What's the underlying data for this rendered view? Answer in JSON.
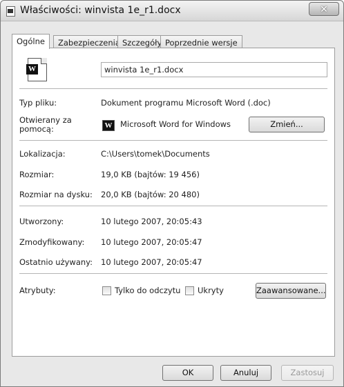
{
  "window": {
    "title": "Właściwości: winvista 1e_r1.docx",
    "close_label": "✕"
  },
  "tabs": [
    {
      "label": "Ogólne",
      "active": true
    },
    {
      "label": "Zabezpieczenia",
      "active": false
    },
    {
      "label": "Szczegóły",
      "active": false
    },
    {
      "label": "Poprzednie wersje",
      "active": false
    }
  ],
  "general": {
    "filename": "winvista 1e_r1.docx",
    "file_type_label": "Typ pliku:",
    "file_type_value": "Dokument programu Microsoft Word  (.doc)",
    "opens_with_label": "Otwierany za pomocą:",
    "opens_with_value": "Microsoft Word for Windows",
    "change_button": "Zmień...",
    "location_label": "Lokalizacja:",
    "location_value": "C:\\Users\\tomek\\Documents",
    "size_label": "Rozmiar:",
    "size_value": "19,0 KB (bajtów: 19 456)",
    "size_on_disk_label": "Rozmiar na dysku:",
    "size_on_disk_value": "20,0 KB (bajtów: 20 480)",
    "created_label": "Utworzony:",
    "created_value": "10 lutego 2007, 20:05:43",
    "modified_label": "Zmodyfikowany:",
    "modified_value": "10 lutego 2007, 20:05:47",
    "accessed_label": "Ostatnio używany:",
    "accessed_value": "10 lutego 2007, 20:05:47",
    "attributes_label": "Atrybuty:",
    "readonly_label": "Tylko do odczytu",
    "hidden_label": "Ukryty",
    "advanced_button": "Zaawansowane..."
  },
  "footer": {
    "ok": "OK",
    "cancel": "Anuluj",
    "apply": "Zastosuj"
  },
  "icons": {
    "doc": "W"
  }
}
